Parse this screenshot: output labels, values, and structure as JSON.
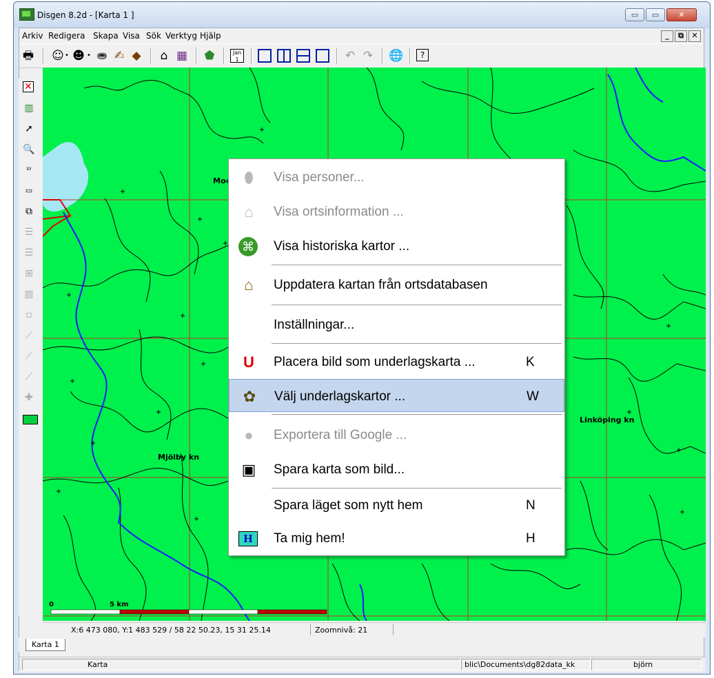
{
  "window": {
    "title": "Disgen 8.2d - [Karta 1 ]"
  },
  "window_buttons": {
    "minimize": "▭",
    "maximize": "▭",
    "close": "✕"
  },
  "menubar": {
    "items": [
      "Arkiv",
      "Redigera",
      "Skapa",
      "Visa",
      "Sök",
      "Verktyg",
      "Hjälp"
    ],
    "mdi_buttons": [
      "_",
      "⧉",
      "✕"
    ]
  },
  "toolbar": {
    "icons": [
      "printer-icon",
      "person-icon",
      "dropdown-arrow-icon",
      "people-search-icon",
      "dropdown-arrow-icon",
      "binoculars-icon",
      "hand-book-icon",
      "book-icon",
      "home-icon",
      "books-icon",
      "map-green-icon",
      "calendar-icon",
      "layout-single-icon",
      "layout-vertical-icon",
      "layout-horizontal-icon",
      "layout-cascade-icon",
      "undo-icon",
      "redo-icon",
      "globe-icon",
      "help-icon"
    ],
    "calendar_label": "Jan 1"
  },
  "map": {
    "towns": [
      "Mo",
      "Mjölby kn",
      "Linköping kn"
    ],
    "scale": {
      "zero": "0",
      "label": "5 km"
    },
    "colors": {
      "land": "#00f04c",
      "water": "#a6e7f4",
      "borders": "#000000",
      "rivers": "#1a1aff",
      "grid": "#c0392b"
    }
  },
  "status_line": {
    "coords": "X:6 473 080, Y:1 483 529 / 58 22 50.23, 15 31 25.14",
    "zoom": "Zoomnivå: 21"
  },
  "tabs": [
    "Karta 1"
  ],
  "status_bar": {
    "panel_mode": "Karta",
    "panel_path": "blic\\Documents\\dg82data_kk",
    "panel_user": "björn"
  },
  "context_menu": {
    "items": [
      {
        "label": "Visa personer...",
        "shortcut": "",
        "enabled": false,
        "icon": "person-head-icon"
      },
      {
        "label": "Visa ortsinformation ...",
        "shortcut": "",
        "enabled": false,
        "icon": "house-icon"
      },
      {
        "label": "Visa historiska kartor ...",
        "shortcut": "",
        "enabled": true,
        "icon": "historic-map-icon"
      },
      {
        "label": "Uppdatera kartan från ortsdatabasen",
        "shortcut": "",
        "enabled": true,
        "icon": "house-update-icon"
      },
      {
        "label": "Inställningar...",
        "shortcut": "",
        "enabled": true,
        "icon": ""
      },
      {
        "label": "Placera bild som underlagskarta ...",
        "shortcut": "K",
        "enabled": true,
        "icon": "u-icon"
      },
      {
        "label": "Välj underlagskartor ...",
        "shortcut": "W",
        "enabled": true,
        "icon": "map-select-icon",
        "highlighted": true
      },
      {
        "label": "Exportera till Google ...",
        "shortcut": "",
        "enabled": false,
        "icon": "google-icon"
      },
      {
        "label": "Spara karta som bild...",
        "shortcut": "",
        "enabled": true,
        "icon": "save-image-icon"
      },
      {
        "label": "Spara läget som nytt hem",
        "shortcut": "N",
        "enabled": true,
        "icon": ""
      },
      {
        "label": "Ta mig hem!",
        "shortcut": "H",
        "enabled": true,
        "icon": "home-h-icon"
      }
    ]
  }
}
